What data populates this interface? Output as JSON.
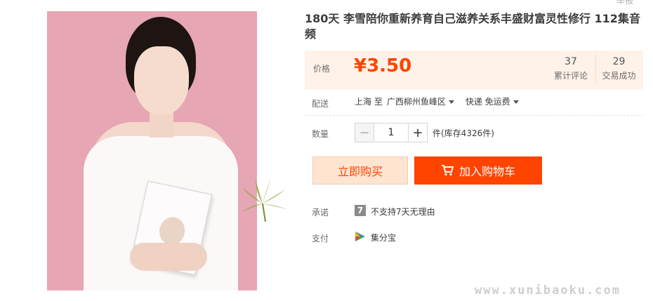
{
  "header": {
    "top_right_fragment": "举报"
  },
  "product": {
    "title": "180天 李雪陪你重新养育自己滋养关系丰盛财富灵性修行 112集音频",
    "image_alt": "product-photo"
  },
  "price": {
    "label": "价格",
    "value": "¥3.50",
    "reviews_count": "37",
    "reviews_label": "累计评论",
    "sales_count": "29",
    "sales_label": "交易成功"
  },
  "shipping": {
    "label": "配送",
    "from": "上海 至",
    "destination": "广西柳州鱼峰区",
    "method": "快递 免运费"
  },
  "quantity": {
    "label": "数量",
    "minus": "−",
    "value": "1",
    "plus": "+",
    "stock": "件(库存4326件)"
  },
  "actions": {
    "buy_now": "立即购买",
    "add_to_cart": "加入购物车"
  },
  "promise": {
    "label": "承诺",
    "icon_text": "7",
    "text": "不支持7天无理由"
  },
  "payment": {
    "label": "支付",
    "text": "集分宝"
  },
  "watermark": "www.xunibaoku.com",
  "colors": {
    "accent": "#ff4400",
    "price_bg": "#fff2e8",
    "buy_now_bg": "#ffe4d0",
    "photo_bg": "#e6a6b3"
  }
}
